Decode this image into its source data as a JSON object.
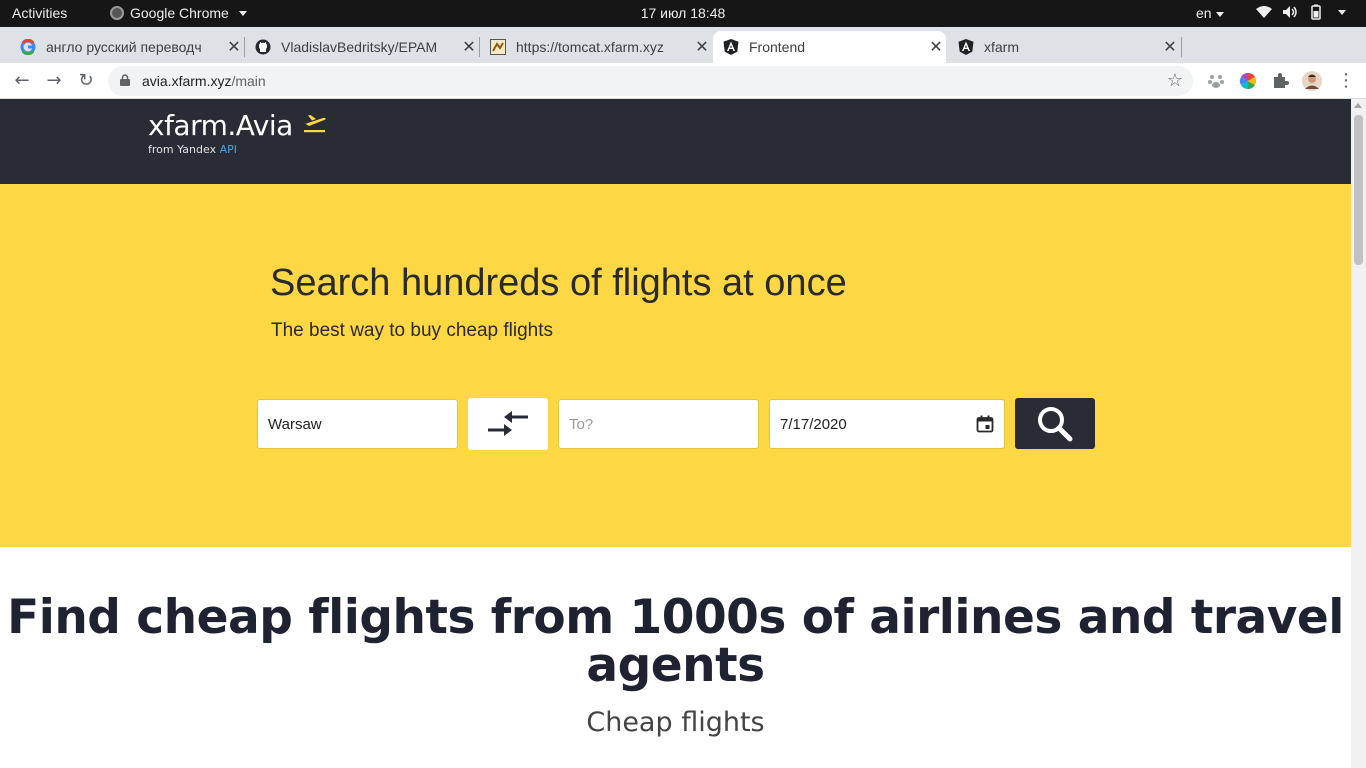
{
  "os": {
    "activities": "Activities",
    "app_name": "Google Chrome",
    "clock": "17 июл  18:48",
    "lang": "en"
  },
  "browser": {
    "tabs": [
      {
        "title": "англо русский переводч",
        "favicon": "google-icon",
        "active": false
      },
      {
        "title": "VladislavBedritsky/EPAM",
        "favicon": "github-icon",
        "active": false
      },
      {
        "title": "https://tomcat.xfarm.xyz",
        "favicon": "tomcat-icon",
        "active": false
      },
      {
        "title": "Frontend",
        "favicon": "angular-icon",
        "active": true
      },
      {
        "title": "xfarm",
        "favicon": "angular-icon",
        "active": false
      }
    ],
    "url_host": "avia.xfarm.xyz",
    "url_path": "/main"
  },
  "site": {
    "brand": "xfarm.Avia",
    "brand_sub": "from Yandex ",
    "brand_sub_api": "API",
    "hero_title": "Search hundreds of flights at once",
    "hero_lead": "The best way to buy cheap flights",
    "from_value": "Warsaw",
    "to_placeholder": "To?",
    "date_value": "7/17/2020",
    "section_title": "Find cheap flights from 1000s of airlines and travel agents",
    "section_sub": "Cheap flights"
  },
  "colors": {
    "header_bg": "#292c35",
    "hero_bg": "#fdd844",
    "accent_yellow": "#fdd844",
    "api_blue": "#4fa3e0"
  }
}
